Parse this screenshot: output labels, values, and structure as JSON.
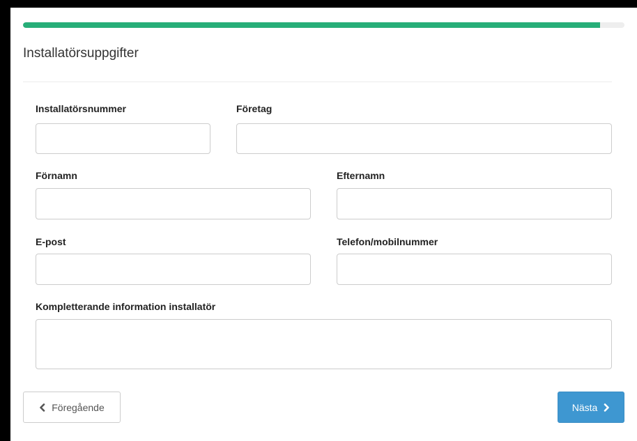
{
  "progress": {
    "value": 0.96,
    "fill_color": "#27ae78",
    "track_color": "#eeeeee"
  },
  "form": {
    "title": "Installatörsuppgifter"
  },
  "fields": {
    "installer_number": {
      "label": "Installatörsnummer",
      "value": ""
    },
    "company": {
      "label": "Företag",
      "value": ""
    },
    "first_name": {
      "label": "Förnamn",
      "value": ""
    },
    "last_name": {
      "label": "Efternamn",
      "value": ""
    },
    "email": {
      "label": "E-post",
      "value": ""
    },
    "phone": {
      "label": "Telefon/mobilnummer",
      "value": ""
    },
    "additional_info": {
      "label": "Kompletterande information installatör",
      "value": ""
    }
  },
  "buttons": {
    "prev": {
      "label": "Föregående",
      "icon": "chevron-left-icon"
    },
    "next": {
      "label": "Nästa",
      "icon": "chevron-right-icon",
      "color": "#3e97d1"
    }
  }
}
